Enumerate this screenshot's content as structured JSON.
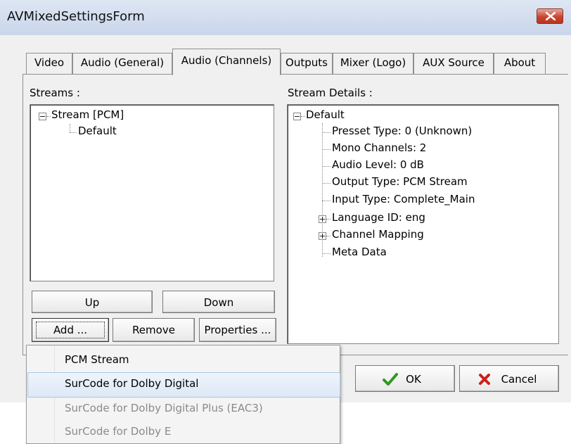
{
  "window": {
    "title": "AVMixedSettingsForm"
  },
  "tabs": [
    {
      "label": "Video"
    },
    {
      "label": "Audio (General)"
    },
    {
      "label": "Audio (Channels)"
    },
    {
      "label": "Outputs"
    },
    {
      "label": "Mixer (Logo)"
    },
    {
      "label": "AUX Source"
    },
    {
      "label": "About"
    }
  ],
  "active_tab": "Audio (Channels)",
  "streams": {
    "label": "Streams :",
    "root": "Stream [PCM]",
    "children": [
      "Default"
    ]
  },
  "details": {
    "label": "Stream Details :",
    "root": "Default",
    "items": [
      "Presset Type: 0 (Unknown)",
      "Mono Channels: 2",
      "Audio Level: 0 dB",
      "Output Type: PCM Stream",
      "Input Type: Complete_Main",
      "Language ID: eng",
      "Channel Mapping",
      "Meta Data"
    ],
    "expandable": [
      "Language ID: eng",
      "Channel Mapping"
    ]
  },
  "buttons": {
    "up": "Up",
    "down": "Down",
    "add": "Add ...",
    "remove": "Remove",
    "properties": "Properties ...",
    "ok": "OK",
    "cancel": "Cancel"
  },
  "menu": {
    "items": [
      {
        "label": "PCM Stream",
        "state": "normal"
      },
      {
        "label": "SurCode for Dolby Digital",
        "state": "highlighted"
      },
      {
        "label": "SurCode for Dolby Digital Plus (EAC3)",
        "state": "disabled"
      },
      {
        "label": "SurCode for Dolby E",
        "state": "disabled"
      }
    ]
  },
  "colors": {
    "ok_check": "#2f9a1e",
    "cancel_x": "#c8231b",
    "close_button": "#c8452f"
  }
}
